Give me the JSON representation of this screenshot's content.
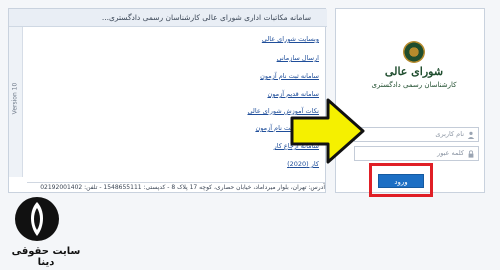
{
  "header": {
    "title": "سامانه مکاتبات اداری شورای عالی کارشناسان رسمی دادگستری..."
  },
  "version_label": "Version 10",
  "links": [
    {
      "label": "وبسایت شورای عالی"
    },
    {
      "label": "ارسال سازمانی"
    },
    {
      "label": "سامانه ثبت نام آزمون"
    },
    {
      "label": "سامانه قدیم آزمون"
    },
    {
      "label": "نکات آموزش شورای عالی"
    },
    {
      "label": "اطلاعات ثبت نام آزمون"
    },
    {
      "label": "سامانه ارجاع کار"
    },
    {
      "label": "کار (2020)"
    }
  ],
  "address": "آدرس: تهران، بلوار میرداماد، خیابان حصاری، کوچه 17 پلاک 8 - کدپستی: 1548655111 - تلفن: 02192001402",
  "organization": {
    "name": "شورای عالی",
    "subtitle": "کارشناسان رسمی دادگستری"
  },
  "login": {
    "username_placeholder": "نام کاربری",
    "password_placeholder": "کلمه عبور",
    "submit_label": "ورود"
  },
  "watermark": {
    "text": "سایت حقوقی دینا"
  },
  "colors": {
    "accent_button": "#1c6fc4",
    "highlight": "#e01f26",
    "arrow_fill": "#f5f000",
    "arrow_stroke": "#111111"
  }
}
